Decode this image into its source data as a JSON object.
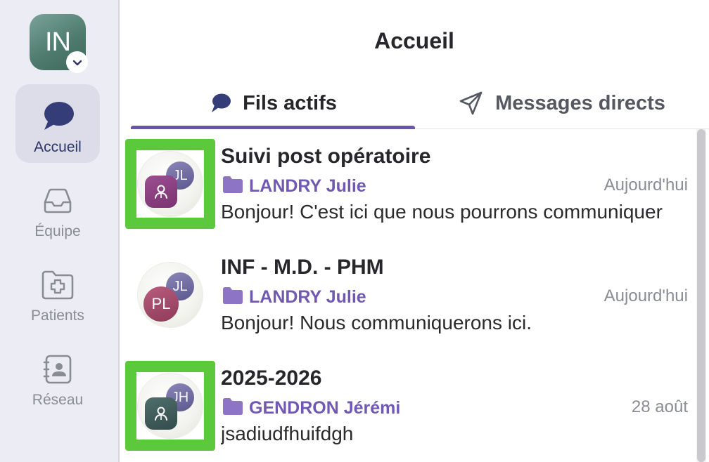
{
  "user": {
    "initials": "IN"
  },
  "nav": [
    {
      "label": "Accueil",
      "icon": "chat-bubble-icon",
      "active": true
    },
    {
      "label": "Équipe",
      "icon": "inbox-icon",
      "active": false
    },
    {
      "label": "Patients",
      "icon": "folder-plus-icon",
      "active": false
    },
    {
      "label": "Réseau",
      "icon": "contact-book-icon",
      "active": false
    }
  ],
  "header": {
    "title": "Accueil"
  },
  "tabs": [
    {
      "label": "Fils actifs",
      "icon": "chat-bubble-icon",
      "active": true
    },
    {
      "label": "Messages directs",
      "icon": "send-icon",
      "active": false
    }
  ],
  "threads": [
    {
      "title": "Suivi post opératoire",
      "owner": "LANDRY Julie",
      "date": "Aujourd'hui",
      "preview": "Bonjour! C'est ici que nous pourrons communiquer",
      "back_initials": "JL",
      "front_initials": "",
      "front_color": "#8a3e80",
      "highlighted": true
    },
    {
      "title": "INF - M.D. - PHM",
      "owner": "LANDRY Julie",
      "date": "Aujourd'hui",
      "preview": "Bonjour! Nous communiquerons ici.",
      "back_initials": "JL",
      "front_initials": "PL",
      "front_color": "#a34a6a",
      "highlighted": false
    },
    {
      "title": "2025-2026",
      "owner": "GENDRON Jérémi",
      "date": "28 août",
      "preview": "jsadiudfhuifdgh",
      "back_initials": "JH",
      "front_initials": "",
      "front_color": "#3e5c5b",
      "highlighted": true
    }
  ],
  "colors": {
    "accent": "#6a55ad",
    "highlight": "#5bc93b",
    "sidebar_bg": "#ecedf4"
  }
}
